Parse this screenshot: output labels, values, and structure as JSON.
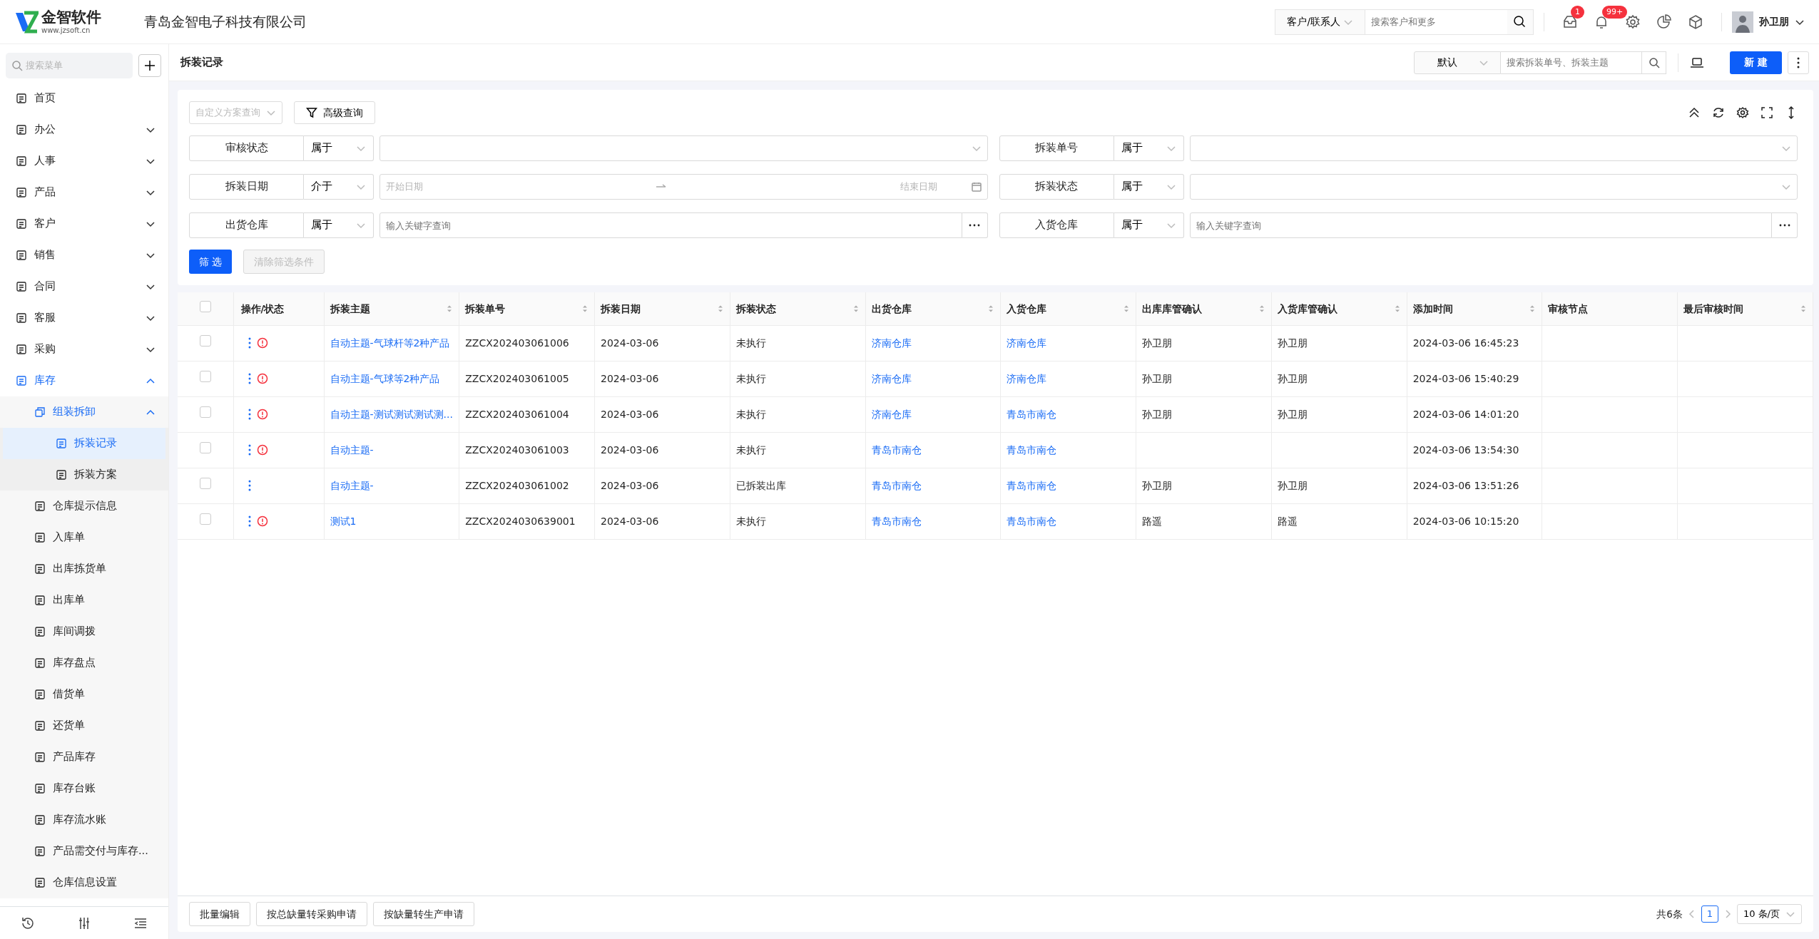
{
  "header": {
    "logo_text": "金智软件",
    "logo_url": "www.jzsoft.cn",
    "company": "青岛金智电子科技有限公司",
    "search": {
      "scope": "客户/联系人",
      "placeholder": "搜索客户和更多"
    },
    "notifications": [
      {
        "kind": "inbox",
        "badge": "1"
      },
      {
        "kind": "bell",
        "badge": "99+"
      }
    ],
    "user": "孙卫朋"
  },
  "sidebar": {
    "search_placeholder": "搜索菜单",
    "items": [
      {
        "label": "首页",
        "selected": false
      },
      {
        "label": "办公",
        "selected": false,
        "expanded": false
      },
      {
        "label": "人事",
        "selected": false,
        "expanded": false
      },
      {
        "label": "产品",
        "selected": false,
        "expanded": false
      },
      {
        "label": "客户",
        "selected": false,
        "expanded": false
      },
      {
        "label": "销售",
        "selected": false,
        "expanded": false
      },
      {
        "label": "合同",
        "selected": false,
        "expanded": false
      },
      {
        "label": "客服",
        "selected": false,
        "expanded": false
      },
      {
        "label": "采购",
        "selected": false,
        "expanded": false
      },
      {
        "label": "库存",
        "selected": false,
        "expanded": true,
        "children": [
          {
            "label": "组装拆卸",
            "selected": false,
            "expanded": true,
            "children": [
              {
                "label": "拆装记录",
                "selected": true
              },
              {
                "label": "拆装方案",
                "selected": false
              }
            ]
          },
          {
            "label": "仓库提示信息",
            "selected": false
          },
          {
            "label": "入库单",
            "selected": false
          },
          {
            "label": "出库拣货单",
            "selected": false
          },
          {
            "label": "出库单",
            "selected": false
          },
          {
            "label": "库间调拨",
            "selected": false
          },
          {
            "label": "库存盘点",
            "selected": false
          },
          {
            "label": "借货单",
            "selected": false
          },
          {
            "label": "还货单",
            "selected": false
          },
          {
            "label": "产品库存",
            "selected": false
          },
          {
            "label": "库存台账",
            "selected": false
          },
          {
            "label": "库存流水账",
            "selected": false
          },
          {
            "label": "产品需交付与库存...",
            "selected": false
          },
          {
            "label": "仓库信息设置",
            "selected": false
          }
        ]
      }
    ]
  },
  "page": {
    "title": "拆装记录",
    "view": "默认",
    "search_placeholder": "搜索拆装单号、拆装主题",
    "new_button": "新 建"
  },
  "filters": {
    "scheme_placeholder": "自定义方案查询",
    "advanced": "高级查询",
    "conditions": [
      {
        "field": "审核状态",
        "operator": "属于",
        "kind": "select"
      },
      {
        "field": "拆装单号",
        "operator": "属于",
        "kind": "select"
      },
      {
        "field": "拆装日期",
        "operator": "介于",
        "kind": "daterange",
        "start_placeholder": "开始日期",
        "end_placeholder": "结束日期"
      },
      {
        "field": "拆装状态",
        "operator": "属于",
        "kind": "select"
      },
      {
        "field": "出货仓库",
        "operator": "属于",
        "kind": "keyword",
        "placeholder": "输入关键字查询"
      },
      {
        "field": "入货仓库",
        "operator": "属于",
        "kind": "keyword",
        "placeholder": "输入关键字查询"
      }
    ],
    "apply": "筛 选",
    "clear": {
      "label": "清除筛选条件",
      "disabled": true
    }
  },
  "table": {
    "select_all": false,
    "columns": [
      {
        "kind": "actions",
        "label": "操作/状态",
        "sortable": false
      },
      {
        "kind": "link",
        "label": "拆装主题",
        "sortable": true
      },
      {
        "kind": "text",
        "label": "拆装单号",
        "sortable": true
      },
      {
        "kind": "text",
        "label": "拆装日期",
        "sortable": true
      },
      {
        "kind": "text",
        "label": "拆装状态",
        "sortable": true
      },
      {
        "kind": "link",
        "label": "出货仓库",
        "sortable": true
      },
      {
        "kind": "link",
        "label": "入货仓库",
        "sortable": true
      },
      {
        "kind": "text",
        "label": "出库库管确认",
        "sortable": true
      },
      {
        "kind": "text",
        "label": "入货库管确认",
        "sortable": true
      },
      {
        "kind": "text",
        "label": "添加时间",
        "sortable": true
      },
      {
        "kind": "text",
        "label": "审核节点",
        "sortable": false
      },
      {
        "kind": "text",
        "label": "最后审核时间",
        "sortable": true
      }
    ],
    "rows": [
      {
        "checked": false,
        "warning": true,
        "cells": [
          "",
          "自动主题-气球杆等2种产品",
          "ZZCX202403061006",
          "2024-03-06",
          "未执行",
          "济南仓库",
          "济南仓库",
          "孙卫朋",
          "孙卫朋",
          "2024-03-06 16:45:23"
        ]
      },
      {
        "checked": false,
        "warning": true,
        "cells": [
          "",
          "自动主题-气球等2种产品",
          "ZZCX202403061005",
          "2024-03-06",
          "未执行",
          "济南仓库",
          "济南仓库",
          "孙卫朋",
          "孙卫朋",
          "2024-03-06 15:40:29"
        ]
      },
      {
        "checked": false,
        "warning": true,
        "cells": [
          "",
          "自动主题-测试测试测试测...",
          "ZZCX202403061004",
          "2024-03-06",
          "未执行",
          "济南仓库",
          "青岛市南仓",
          "孙卫朋",
          "孙卫朋",
          "2024-03-06 14:01:20"
        ]
      },
      {
        "checked": false,
        "warning": true,
        "cells": [
          "",
          "自动主题-",
          "ZZCX202403061003",
          "2024-03-06",
          "未执行",
          "青岛市南仓",
          "青岛市南仓",
          null,
          null,
          "2024-03-06 13:54:30"
        ]
      },
      {
        "checked": false,
        "warning": false,
        "cells": [
          "",
          "自动主题-",
          "ZZCX202403061002",
          "2024-03-06",
          "已拆装出库",
          "青岛市南仓",
          "青岛市南仓",
          "孙卫朋",
          "孙卫朋",
          "2024-03-06 13:51:26"
        ]
      },
      {
        "checked": false,
        "warning": true,
        "cells": [
          "",
          "测试1",
          "ZZCX2024030639001",
          "2024-03-06",
          "未执行",
          "青岛市南仓",
          "青岛市南仓",
          "路遥",
          "路遥",
          "2024-03-06 10:15:20"
        ]
      }
    ]
  },
  "footer": {
    "buttons": [
      "批量编辑",
      "按总缺量转采购申请",
      "按缺量转生产申请"
    ],
    "total": "共6条",
    "pages": [
      {
        "label": "1",
        "selected": true
      }
    ],
    "page_size": "10 条/页"
  }
}
